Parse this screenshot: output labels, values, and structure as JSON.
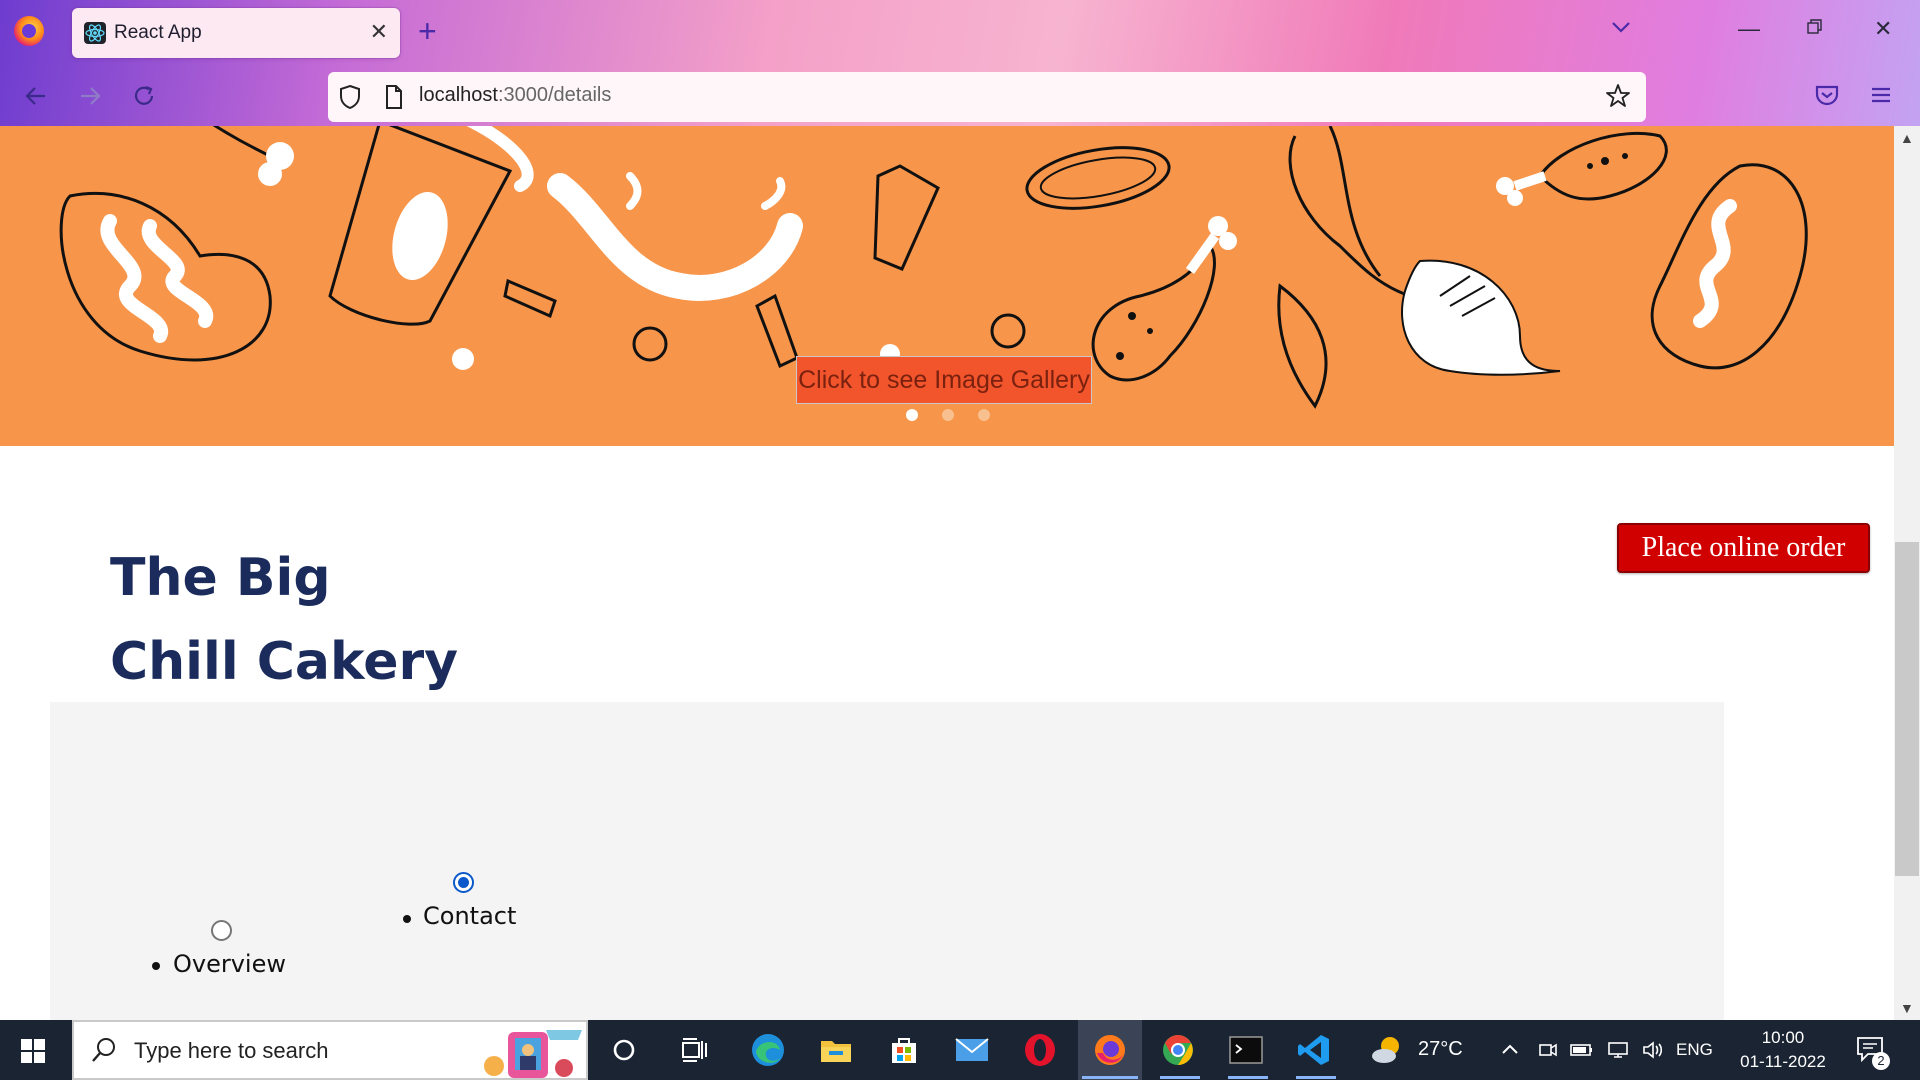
{
  "browser": {
    "tab_title": "React App",
    "url_host": "localhost",
    "url_rest": ":3000/details"
  },
  "page": {
    "gallery_button": "Click to see Image Gallery",
    "order_button": "Place online order",
    "restaurant_name": "The Big Chill Cakery",
    "tabs": [
      {
        "label": "Overview",
        "checked": false
      },
      {
        "label": "Contact",
        "checked": true
      }
    ],
    "carousel": {
      "count": 3,
      "active_index": 0
    }
  },
  "taskbar": {
    "search_placeholder": "Type here to search",
    "weather_temp": "27°C",
    "language": "ENG",
    "time": "10:00",
    "date": "01-11-2022",
    "notifications": "2"
  },
  "colors": {
    "hero_bg": "#f7954a",
    "gallery_button_bg": "#f2542b",
    "order_button_bg": "#d10000",
    "heading": "#1a2b5c",
    "panel_bg": "#f4f4f4",
    "taskbar_bg": "#1b2433"
  }
}
